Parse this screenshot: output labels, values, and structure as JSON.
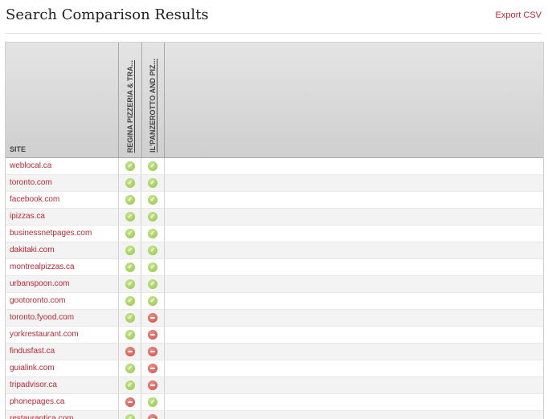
{
  "header": {
    "title": "Search Comparison Results",
    "export_label": "Export CSV"
  },
  "table": {
    "site_header": "SITE",
    "columns": [
      "REGINA PIZZERIA & TRA...",
      "IL'PANZEROTTO AND PIZ..."
    ],
    "rows": [
      {
        "site": "weblocal.ca",
        "a": "yes",
        "b": "yes"
      },
      {
        "site": "toronto.com",
        "a": "yes",
        "b": "yes"
      },
      {
        "site": "facebook.com",
        "a": "yes",
        "b": "yes"
      },
      {
        "site": "ipizzas.ca",
        "a": "yes",
        "b": "yes"
      },
      {
        "site": "businessnetpages.com",
        "a": "yes",
        "b": "yes"
      },
      {
        "site": "dakitaki.com",
        "a": "yes",
        "b": "yes"
      },
      {
        "site": "montrealpizzas.ca",
        "a": "yes",
        "b": "yes"
      },
      {
        "site": "urbanspoon.com",
        "a": "yes",
        "b": "yes"
      },
      {
        "site": "gootoronto.com",
        "a": "yes",
        "b": "yes"
      },
      {
        "site": "toronto.fyood.com",
        "a": "yes",
        "b": "no"
      },
      {
        "site": "yorkrestaurant.com",
        "a": "yes",
        "b": "no"
      },
      {
        "site": "findusfast.ca",
        "a": "no",
        "b": "no"
      },
      {
        "site": "guialink.com",
        "a": "yes",
        "b": "no"
      },
      {
        "site": "tripadvisor.ca",
        "a": "yes",
        "b": "no"
      },
      {
        "site": "phonepages.ca",
        "a": "no",
        "b": "yes"
      },
      {
        "site": "restaurantica.com",
        "a": "yes",
        "b": "no"
      }
    ]
  },
  "icons": {
    "yes": "check-circle-icon",
    "no": "minus-circle-icon"
  },
  "colors": {
    "link": "#c62633",
    "yes": "#93c24a",
    "no": "#cf4c43"
  }
}
